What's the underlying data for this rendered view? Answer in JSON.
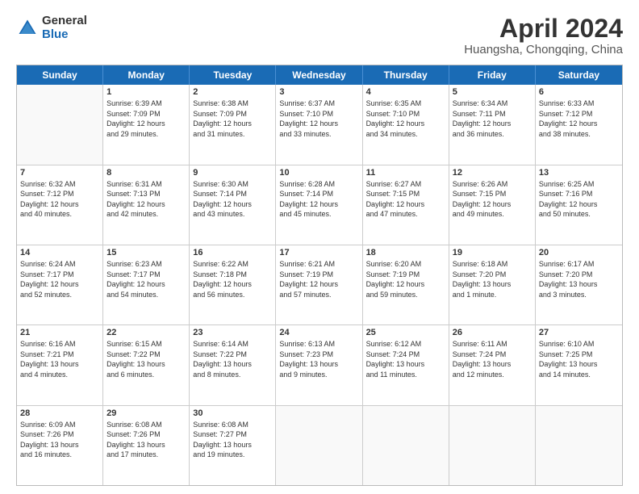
{
  "logo": {
    "general": "General",
    "blue": "Blue"
  },
  "title": "April 2024",
  "subtitle": "Huangsha, Chongqing, China",
  "days_of_week": [
    "Sunday",
    "Monday",
    "Tuesday",
    "Wednesday",
    "Thursday",
    "Friday",
    "Saturday"
  ],
  "weeks": [
    [
      {
        "day": "",
        "lines": []
      },
      {
        "day": "1",
        "lines": [
          "Sunrise: 6:39 AM",
          "Sunset: 7:09 PM",
          "Daylight: 12 hours",
          "and 29 minutes."
        ]
      },
      {
        "day": "2",
        "lines": [
          "Sunrise: 6:38 AM",
          "Sunset: 7:09 PM",
          "Daylight: 12 hours",
          "and 31 minutes."
        ]
      },
      {
        "day": "3",
        "lines": [
          "Sunrise: 6:37 AM",
          "Sunset: 7:10 PM",
          "Daylight: 12 hours",
          "and 33 minutes."
        ]
      },
      {
        "day": "4",
        "lines": [
          "Sunrise: 6:35 AM",
          "Sunset: 7:10 PM",
          "Daylight: 12 hours",
          "and 34 minutes."
        ]
      },
      {
        "day": "5",
        "lines": [
          "Sunrise: 6:34 AM",
          "Sunset: 7:11 PM",
          "Daylight: 12 hours",
          "and 36 minutes."
        ]
      },
      {
        "day": "6",
        "lines": [
          "Sunrise: 6:33 AM",
          "Sunset: 7:12 PM",
          "Daylight: 12 hours",
          "and 38 minutes."
        ]
      }
    ],
    [
      {
        "day": "7",
        "lines": [
          "Sunrise: 6:32 AM",
          "Sunset: 7:12 PM",
          "Daylight: 12 hours",
          "and 40 minutes."
        ]
      },
      {
        "day": "8",
        "lines": [
          "Sunrise: 6:31 AM",
          "Sunset: 7:13 PM",
          "Daylight: 12 hours",
          "and 42 minutes."
        ]
      },
      {
        "day": "9",
        "lines": [
          "Sunrise: 6:30 AM",
          "Sunset: 7:14 PM",
          "Daylight: 12 hours",
          "and 43 minutes."
        ]
      },
      {
        "day": "10",
        "lines": [
          "Sunrise: 6:28 AM",
          "Sunset: 7:14 PM",
          "Daylight: 12 hours",
          "and 45 minutes."
        ]
      },
      {
        "day": "11",
        "lines": [
          "Sunrise: 6:27 AM",
          "Sunset: 7:15 PM",
          "Daylight: 12 hours",
          "and 47 minutes."
        ]
      },
      {
        "day": "12",
        "lines": [
          "Sunrise: 6:26 AM",
          "Sunset: 7:15 PM",
          "Daylight: 12 hours",
          "and 49 minutes."
        ]
      },
      {
        "day": "13",
        "lines": [
          "Sunrise: 6:25 AM",
          "Sunset: 7:16 PM",
          "Daylight: 12 hours",
          "and 50 minutes."
        ]
      }
    ],
    [
      {
        "day": "14",
        "lines": [
          "Sunrise: 6:24 AM",
          "Sunset: 7:17 PM",
          "Daylight: 12 hours",
          "and 52 minutes."
        ]
      },
      {
        "day": "15",
        "lines": [
          "Sunrise: 6:23 AM",
          "Sunset: 7:17 PM",
          "Daylight: 12 hours",
          "and 54 minutes."
        ]
      },
      {
        "day": "16",
        "lines": [
          "Sunrise: 6:22 AM",
          "Sunset: 7:18 PM",
          "Daylight: 12 hours",
          "and 56 minutes."
        ]
      },
      {
        "day": "17",
        "lines": [
          "Sunrise: 6:21 AM",
          "Sunset: 7:19 PM",
          "Daylight: 12 hours",
          "and 57 minutes."
        ]
      },
      {
        "day": "18",
        "lines": [
          "Sunrise: 6:20 AM",
          "Sunset: 7:19 PM",
          "Daylight: 12 hours",
          "and 59 minutes."
        ]
      },
      {
        "day": "19",
        "lines": [
          "Sunrise: 6:18 AM",
          "Sunset: 7:20 PM",
          "Daylight: 13 hours",
          "and 1 minute."
        ]
      },
      {
        "day": "20",
        "lines": [
          "Sunrise: 6:17 AM",
          "Sunset: 7:20 PM",
          "Daylight: 13 hours",
          "and 3 minutes."
        ]
      }
    ],
    [
      {
        "day": "21",
        "lines": [
          "Sunrise: 6:16 AM",
          "Sunset: 7:21 PM",
          "Daylight: 13 hours",
          "and 4 minutes."
        ]
      },
      {
        "day": "22",
        "lines": [
          "Sunrise: 6:15 AM",
          "Sunset: 7:22 PM",
          "Daylight: 13 hours",
          "and 6 minutes."
        ]
      },
      {
        "day": "23",
        "lines": [
          "Sunrise: 6:14 AM",
          "Sunset: 7:22 PM",
          "Daylight: 13 hours",
          "and 8 minutes."
        ]
      },
      {
        "day": "24",
        "lines": [
          "Sunrise: 6:13 AM",
          "Sunset: 7:23 PM",
          "Daylight: 13 hours",
          "and 9 minutes."
        ]
      },
      {
        "day": "25",
        "lines": [
          "Sunrise: 6:12 AM",
          "Sunset: 7:24 PM",
          "Daylight: 13 hours",
          "and 11 minutes."
        ]
      },
      {
        "day": "26",
        "lines": [
          "Sunrise: 6:11 AM",
          "Sunset: 7:24 PM",
          "Daylight: 13 hours",
          "and 12 minutes."
        ]
      },
      {
        "day": "27",
        "lines": [
          "Sunrise: 6:10 AM",
          "Sunset: 7:25 PM",
          "Daylight: 13 hours",
          "and 14 minutes."
        ]
      }
    ],
    [
      {
        "day": "28",
        "lines": [
          "Sunrise: 6:09 AM",
          "Sunset: 7:26 PM",
          "Daylight: 13 hours",
          "and 16 minutes."
        ]
      },
      {
        "day": "29",
        "lines": [
          "Sunrise: 6:08 AM",
          "Sunset: 7:26 PM",
          "Daylight: 13 hours",
          "and 17 minutes."
        ]
      },
      {
        "day": "30",
        "lines": [
          "Sunrise: 6:08 AM",
          "Sunset: 7:27 PM",
          "Daylight: 13 hours",
          "and 19 minutes."
        ]
      },
      {
        "day": "",
        "lines": []
      },
      {
        "day": "",
        "lines": []
      },
      {
        "day": "",
        "lines": []
      },
      {
        "day": "",
        "lines": []
      }
    ]
  ]
}
